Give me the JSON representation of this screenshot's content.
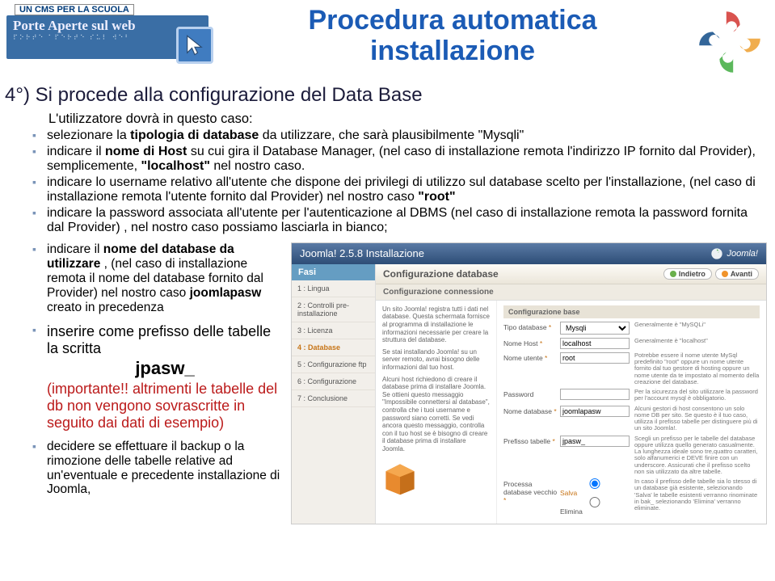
{
  "header": {
    "cms_tag": "UN CMS PER LA SCUOLA",
    "cms_title": "Porte Aperte sul web",
    "page_title_l1": "Procedura automatica",
    "page_title_l2": "installazione"
  },
  "section_title": "4°) Si procede alla configurazione del Data Base",
  "intro": "L'utilizzatore dovrà in questo caso:",
  "bullets_top": [
    {
      "pre": "selezionare la ",
      "b": "tipologia di database",
      "post": " da utilizzare, che sarà plausibilmente \"Mysqli\""
    },
    {
      "pre": "indicare il ",
      "b": "nome di Host",
      "mid": " su cui gira il Database Manager, (nel caso di installazione remota l'indirizzo IP fornito dal Provider), semplicemente, ",
      "b2": "\"localhost\"",
      "post": " nel nostro caso."
    },
    {
      "pre": "indicare lo username relativo all'utente che dispone dei privilegi di utilizzo sul database scelto per l'installazione,  (nel caso di installazione remota l'utente  fornito dal Provider) nel nostro caso  ",
      "b": "\"root\"",
      "post": ""
    },
    {
      "pre": "indicare la password associata all'utente per l'autenticazione al DBMS (nel caso di installazione remota la password fornita dal Provider) , nel nostro caso possiamo lasciarla in bianco;",
      "b": "",
      "post": ""
    }
  ],
  "left_b1": {
    "pre": "indicare il ",
    "b": "nome del database da utilizzare",
    "mid": " , (nel caso di installazione remota il nome del database  fornito dal Provider) nel nostro caso ",
    "b2": "joomlapasw",
    "post": " creato in precedenza"
  },
  "left_b2": {
    "line1": "inserire come prefisso delle tabelle la scritta",
    "prefix": "jpasw_",
    "imp1": "(importante!!",
    "imp2": " altrimenti le tabelle del db non vengono sovrascritte in seguito dai dati di esempio)"
  },
  "left_b3": "decidere se effettuare il backup o la rimozione delle tabelle relative ad un'eventuale e precedente installazione di Joomla,",
  "ss": {
    "title": "Joomla! 2.5.8 Installazione",
    "brand": "Joomla!",
    "side_hdr": "Fasi",
    "steps": [
      "1 : Lingua",
      "2 : Controlli pre-installazione",
      "3 : Licenza",
      "4 : Database",
      "5 : Configurazione ftp",
      "6 : Configurazione",
      "7 : Conclusione"
    ],
    "active_step": 3,
    "main_hdr": "Configurazione database",
    "btn_back": "Indietro",
    "btn_next": "Avanti",
    "sub_hdr": "Configurazione connessione",
    "c1_p1": "Un sito Joomla! registra tutti i dati nel database. Questa schermata fornisce al programma di installazione le informazioni necessarie per creare la struttura del database.",
    "c1_p2": "Se stai installando Joomla! su un server remoto, avrai bisogno delle informazioni dal tuo host.",
    "c1_p3": "Alcuni host richiedono di creare il database prima di installare Joomla. Se ottieni questo messaggio \"Impossibile connettersi al database\", controlla che i tuoi username e password siano corretti. Se vedi ancora questo messaggio, controlla con il tuo host se è bisogno di creare il database prima di installare Joomla.",
    "base_hdr": "Configurazione base",
    "rows": [
      {
        "label": "Tipo database",
        "ast": "*",
        "type": "select",
        "value": "Mysqli",
        "hint": "Generalmente è \"MySQLi\""
      },
      {
        "label": "Nome Host",
        "ast": "*",
        "type": "text",
        "value": "localhost",
        "hint": "Generalmente è \"localhost\""
      },
      {
        "label": "Nome utente",
        "ast": "*",
        "type": "text",
        "value": "root",
        "hint": "Potrebbe essere il nome utente MySql predefinito \"root\" oppure un nome utente fornito dal tuo gestore di hosting oppure un nome utente da te impostato al momento della creazione del database."
      },
      {
        "label": "Password",
        "ast": "",
        "type": "text",
        "value": "",
        "hint": "Per la sicurezza del sito utilizzare la password per l'account mysql è obbligatorio."
      },
      {
        "label": "Nome database",
        "ast": "*",
        "type": "text",
        "value": "joomlapasw",
        "hint": "Alcuni gestori di host consentono un solo nome DB per sito. Se questo è il tuo caso, utilizza il prefisso tabelle per distinguere più di un sito Joomla!."
      },
      {
        "label": "Prefisso tabelle",
        "ast": "*",
        "type": "text",
        "value": "jpasw_",
        "hint": "Scegli un prefisso per le tabelle del database oppure utilizza quello generato casualmente. La lunghezza ideale sono tre,quattro caratteri, solo alfanumerici e DEVE finire con un underscore. Assicurati che il prefisso scelto non sia utilizzato da altre tabelle."
      }
    ],
    "proc_hdr": "Processa database vecchio",
    "proc_ast": "*",
    "radio1": "Salva",
    "radio2": "Elimina",
    "proc_hint": "In caso il prefisso delle tabelle sia lo stesso di un database già esistente, selezionando 'Salva' le tabelle esistenti verranno rinominate in bak_ selezionando 'Elimina' verranno eliminate."
  }
}
